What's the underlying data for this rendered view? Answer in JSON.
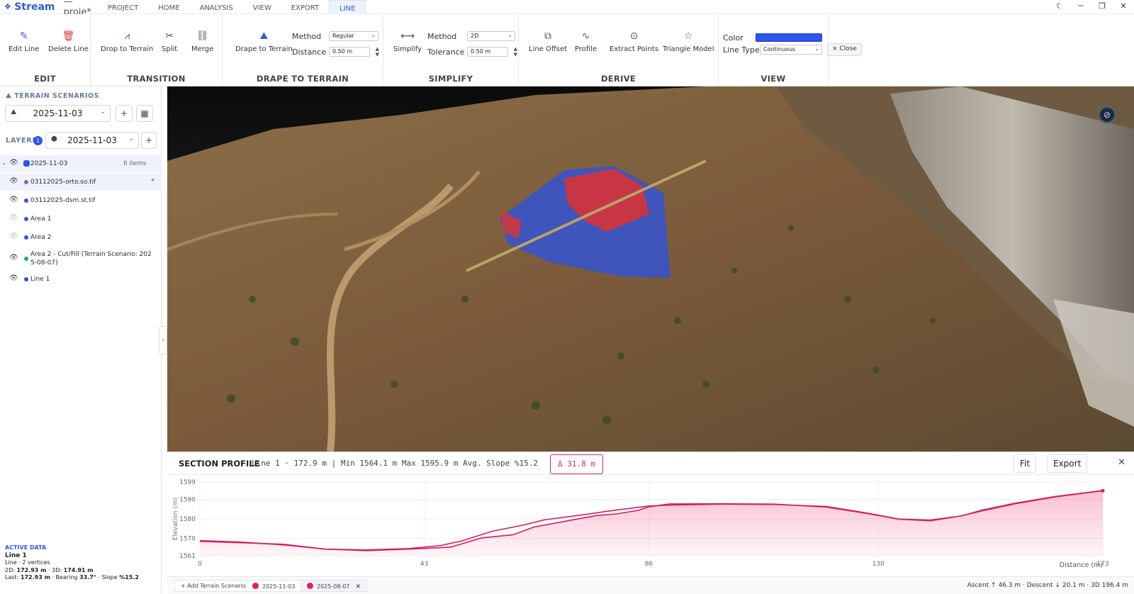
{
  "app": {
    "name": "Stream",
    "project": "— proje*"
  },
  "menu_tabs": [
    {
      "label": "PROJECT"
    },
    {
      "label": "HOME"
    },
    {
      "label": "ANALYSIS"
    },
    {
      "label": "VIEW"
    },
    {
      "label": "EXPORT"
    },
    {
      "label": "LINE",
      "active": true
    }
  ],
  "window_controls": {
    "theme_icon": "moon-icon",
    "minimize": "─",
    "maximize": "❐",
    "close": "✕"
  },
  "ribbon": {
    "edit": {
      "title": "EDIT",
      "edit_line": "Edit Line",
      "delete_line": "Delete Line"
    },
    "transition": {
      "title": "TRANSITION",
      "drop_to_terrain": "Drop to Terrain",
      "split": "Split",
      "merge": "Merge"
    },
    "drape": {
      "title": "DRAPE TO TERRAIN",
      "drape_to_terrain": "Drape to Terrain",
      "method_label": "Method",
      "method_value": "Regular",
      "distance_label": "Distance",
      "distance_value": "0.50 m"
    },
    "simplify": {
      "title": "SIMPLIFY",
      "simplify": "Simplify",
      "method_label": "Method",
      "method_value": "2D",
      "tolerance_label": "Tolerance",
      "tolerance_value": "0.50 m"
    },
    "derive": {
      "title": "DERIVE",
      "line_offset": "Line Offset",
      "profile": "Profile",
      "extract_points": "Extract Points",
      "triangle_model": "Triangle Model"
    },
    "view": {
      "title": "VIEW",
      "color_label": "Color",
      "color_value": "#2f54eb",
      "line_type_label": "Line Type",
      "line_type_value": "Continuous",
      "close": "× Close"
    }
  },
  "left_panel": {
    "terrain_scenarios_title": "TERRAIN SCENARIOS",
    "scenario_value": "2025-11-03",
    "layers_title": "LAYERS",
    "layers_badge": "1",
    "layers_select": "2025-11-03",
    "layers": [
      {
        "name": "2025-11-03",
        "count": "6 items",
        "dot": "#2f54eb"
      },
      {
        "name": "03112025-orto.so.tif",
        "dot": "#9b59d0"
      },
      {
        "name": "03112025-dsm.st.tif",
        "dot": "#2f54eb"
      },
      {
        "name": "Area 1",
        "dot": "#2f54eb"
      },
      {
        "name": "Area 2",
        "dot": "#2f54eb"
      },
      {
        "name": "Area 2 - Cut/Fill (Terrain Scenario: 202",
        "name2": "5-08-07)",
        "dot": "#27ae60"
      },
      {
        "name": "Line 1",
        "dot": "#2f54eb"
      }
    ],
    "active_data": {
      "title": "ACTIVE DATA",
      "name": "Line 1",
      "sub": "Line · 2 vertices",
      "line2d_label": "2D: ",
      "line2d_value": "172.93 m",
      "line3d_label": " · 3D: ",
      "line3d_value": "174.91 m",
      "last_label": "Last: ",
      "last_value": "172.93 m",
      "bearing_label": " · Bearing ",
      "bearing_value": "33.7°",
      "slope_label": " · Slope ",
      "slope_value": "%15.2"
    }
  },
  "profile": {
    "title": "SECTION PROFILE",
    "stats": "Line 1 · 172.9 m | Min 1564.1 m Max 1595.9 m Avg. Slope %15.2",
    "delta": "Δ 31.8 m",
    "fit": "Fit",
    "export": "Export",
    "close": "✕"
  },
  "chart_data": {
    "type": "line",
    "ylabel": "Elevation (m)",
    "xlabel": "Distance (m)",
    "xlim": [
      0,
      173
    ],
    "ylim": [
      1561,
      1599
    ],
    "x_ticks": [
      0,
      43,
      86,
      130,
      173
    ],
    "y_ticks": [
      1561,
      1570,
      1580,
      1590,
      1599
    ],
    "series": [
      {
        "color": "#d81b60",
        "x": [
          0,
          8,
          16,
          24,
          32,
          40,
          44,
          48,
          54,
          60,
          64,
          70,
          76,
          80,
          84,
          86,
          90,
          100,
          110,
          120,
          128,
          134,
          140,
          146,
          150,
          156,
          164,
          173
        ],
        "y": [
          1568.4,
          1567.7,
          1566.9,
          1564.4,
          1563.6,
          1564.4,
          1564.9,
          1565.4,
          1570.2,
          1571.8,
          1575.8,
          1578.8,
          1581.7,
          1582.6,
          1584.4,
          1586.2,
          1587.7,
          1587.8,
          1587.6,
          1586.1,
          1582.7,
          1579.8,
          1579.0,
          1581.6,
          1584.2,
          1587.7,
          1591.4,
          1594.5
        ]
      },
      {
        "color": "#d81b60",
        "x": [
          0,
          8,
          16,
          24,
          32,
          40,
          46,
          50,
          56,
          62,
          66,
          70,
          74,
          78,
          80,
          86,
          90,
          100,
          110,
          120,
          128,
          134,
          140,
          146,
          150,
          156,
          164,
          173
        ],
        "y": [
          1568.8,
          1568.0,
          1566.6,
          1564.4,
          1564.0,
          1564.7,
          1566.2,
          1568.5,
          1573.6,
          1576.8,
          1579.5,
          1580.9,
          1582.3,
          1583.9,
          1584.6,
          1586.6,
          1587.1,
          1587.6,
          1587.4,
          1586.4,
          1582.9,
          1579.9,
          1579.4,
          1581.6,
          1584.6,
          1588.0,
          1591.6,
          1594.6
        ]
      }
    ]
  },
  "status": {
    "add_scenario": "+ Add Terrain Scenario",
    "tab1": "2025-11-03",
    "tab2": "2025-08-07",
    "tab2_close": "✕",
    "right": "Ascent ↑ 46.3 m · Descent ↓ 20.1 m · 3D 196.4 m"
  }
}
